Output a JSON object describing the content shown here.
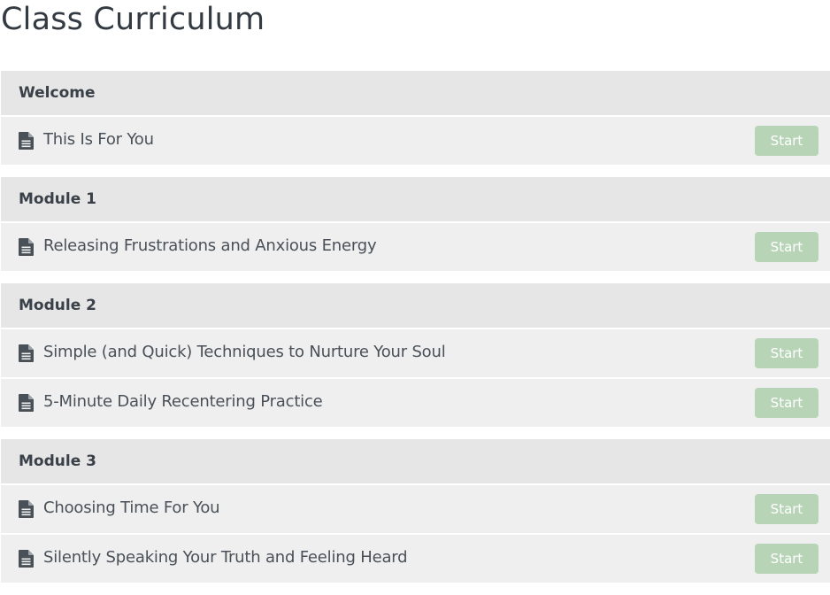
{
  "page": {
    "title": "Class Curriculum"
  },
  "colors": {
    "section_header_bg": "#e6e6e6",
    "item_bg": "#efefef",
    "start_button_bg": "#b7d4b6",
    "start_button_text": "#ffffff",
    "title_text": "#333a42"
  },
  "icons": {
    "lecture": "document-icon"
  },
  "sections": [
    {
      "title": "Welcome",
      "items": [
        {
          "label": "This Is For You",
          "button": "Start"
        }
      ]
    },
    {
      "title": "Module 1",
      "items": [
        {
          "label": "Releasing Frustrations and Anxious Energy",
          "button": "Start"
        }
      ]
    },
    {
      "title": "Module 2",
      "items": [
        {
          "label": "Simple (and Quick) Techniques to Nurture Your Soul",
          "button": "Start"
        },
        {
          "label": "5-Minute Daily Recentering Practice",
          "button": "Start"
        }
      ]
    },
    {
      "title": "Module 3",
      "items": [
        {
          "label": "Choosing Time For You",
          "button": "Start"
        },
        {
          "label": "Silently Speaking Your Truth and Feeling Heard",
          "button": "Start"
        }
      ]
    }
  ]
}
